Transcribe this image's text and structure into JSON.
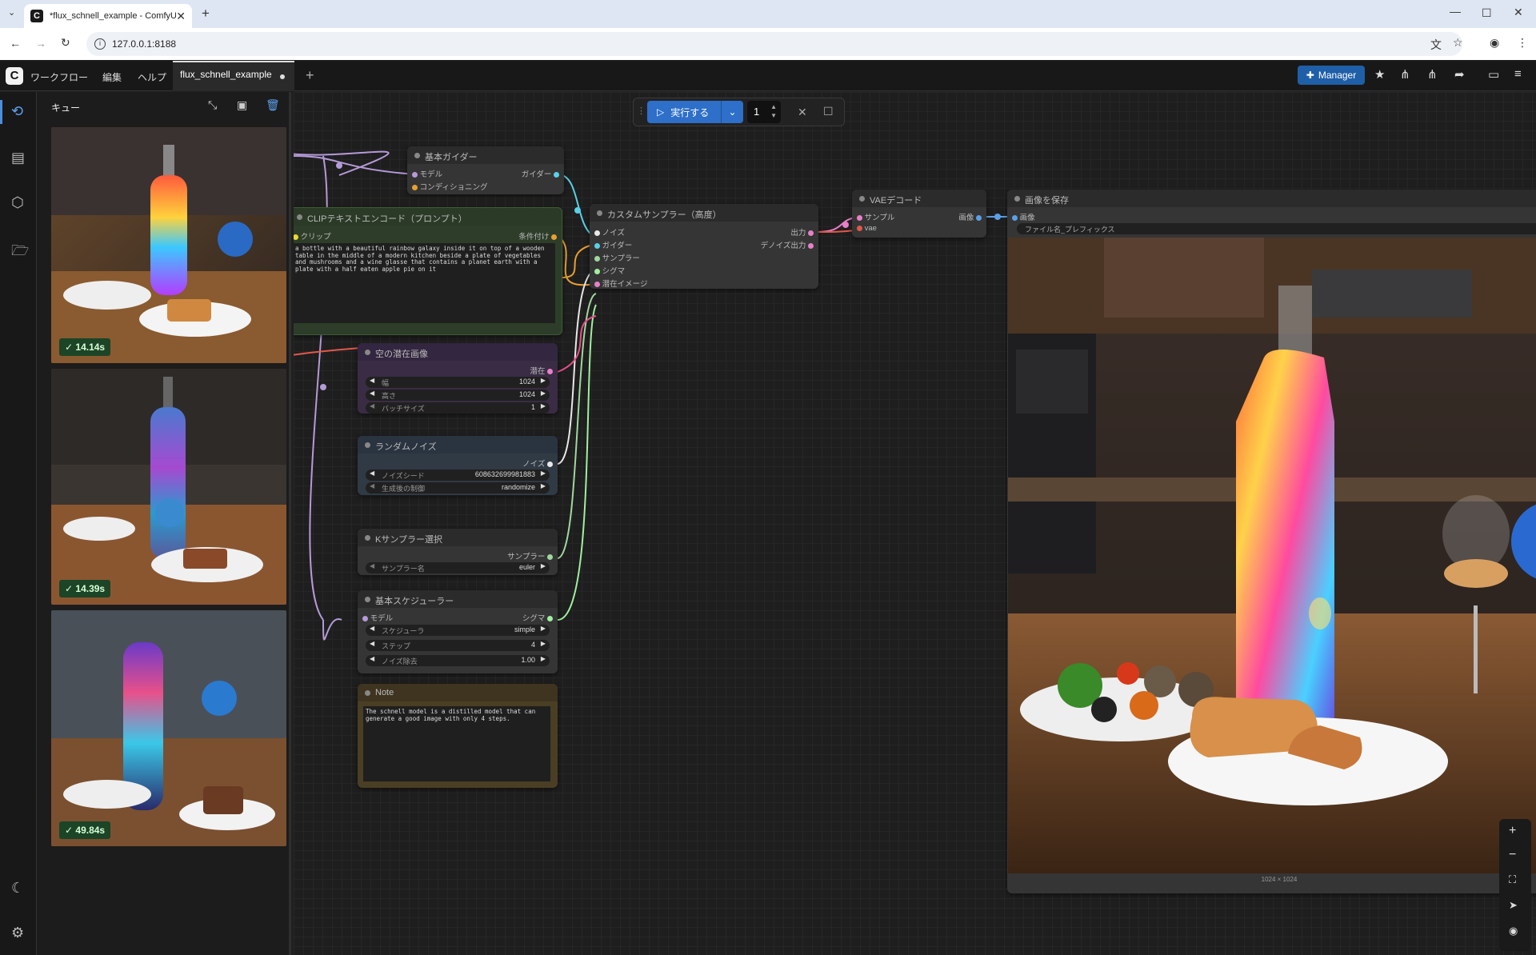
{
  "browser": {
    "tab_title": "*flux_schnell_example - ComfyUI",
    "url": "127.0.0.1:8188"
  },
  "menubar": {
    "workflow": "ワークフロー",
    "edit": "編集",
    "help": "ヘルプ",
    "workflow_tab": "flux_schnell_example",
    "manager": "Manager"
  },
  "queue": {
    "title": "キュー",
    "items": [
      {
        "time": "14.14s"
      },
      {
        "time": "14.39s"
      },
      {
        "time": "49.84s"
      }
    ]
  },
  "runbar": {
    "run_label": "実行する",
    "count": "1"
  },
  "nodes": {
    "guider": {
      "title": "基本ガイダー",
      "in_model": "モデル",
      "in_cond": "コンディショニング",
      "out": "ガイダー"
    },
    "clip": {
      "title": "CLIPテキストエンコード（プロンプト）",
      "in_clip": "クリップ",
      "out": "条件付け",
      "text": "a bottle with a beautiful rainbow galaxy inside it on top of a wooden table in the middle of a modern kitchen beside a plate of vegetables and mushrooms and a wine glasse that contains a planet earth with a plate with a half eaten apple pie on it"
    },
    "sampler_adv": {
      "title": "カスタムサンプラー（高度）",
      "in_noise": "ノイズ",
      "in_guider": "ガイダー",
      "in_sampler": "サンプラー",
      "in_sigmas": "シグマ",
      "in_latent": "潜在イメージ",
      "out1": "出力",
      "out2": "デノイズ出力"
    },
    "vae": {
      "title": "VAEデコード",
      "in_samples": "サンプル",
      "in_vae": "vae",
      "out": "画像"
    },
    "save": {
      "title": "画像を保存",
      "in_images": "画像",
      "prefix": "ファイル名_プレフィックス",
      "size": "1024 × 1024"
    },
    "latent": {
      "title": "空の潜在画像",
      "out": "潜在",
      "w_label": "幅",
      "w_val": "1024",
      "h_label": "高さ",
      "h_val": "1024",
      "b_label": "バッチサイズ",
      "b_val": "1"
    },
    "noise": {
      "title": "ランダムノイズ",
      "out": "ノイズ",
      "seed_label": "ノイズシード",
      "seed_val": "608632699981883",
      "ctrl_label": "生成後の制御",
      "ctrl_val": "randomize"
    },
    "ksel": {
      "title": "Kサンプラー選択",
      "out": "サンプラー",
      "name_label": "サンプラー名",
      "name_val": "euler"
    },
    "sched": {
      "title": "基本スケジューラー",
      "in_model": "モデル",
      "out": "シグマ",
      "s_label": "スケジューラ",
      "s_val": "simple",
      "st_label": "ステップ",
      "st_val": "4",
      "d_label": "ノイズ除去",
      "d_val": "1.00"
    },
    "note": {
      "title": "Note",
      "text": "The schnell model is a distilled model that can generate a good image with only 4 steps."
    }
  }
}
